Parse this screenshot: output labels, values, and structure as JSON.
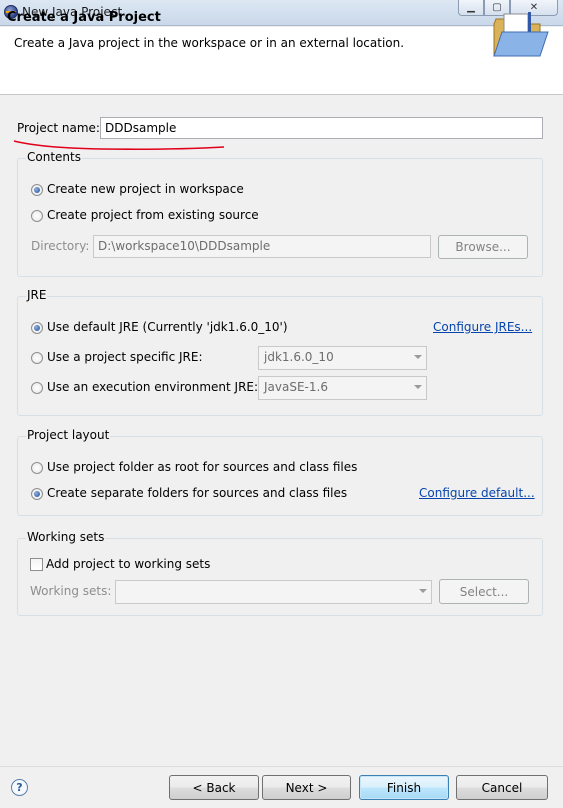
{
  "window": {
    "title": "New Java Project",
    "min_glyph": "▁",
    "max_glyph": "▢",
    "close_glyph": "✕"
  },
  "header": {
    "title": "Create a Java Project",
    "description": "Create a Java project in the workspace or in an external location."
  },
  "project_name": {
    "label": "Project name:",
    "value": "DDDsample"
  },
  "contents": {
    "title": "Contents",
    "option_new": "Create new project in workspace",
    "option_existing": "Create project from existing source",
    "selected": "option_new",
    "directory_label": "Directory:",
    "directory_value": "D:\\workspace10\\DDDsample",
    "browse_label": "Browse..."
  },
  "jre": {
    "title": "JRE",
    "option_default": "Use default JRE (Currently 'jdk1.6.0_10')",
    "configure_link": "Configure JREs...",
    "option_specific": "Use a project specific JRE:",
    "specific_value": "jdk1.6.0_10",
    "option_env": "Use an execution environment JRE:",
    "env_value": "JavaSE-1.6",
    "selected": "option_default"
  },
  "layout": {
    "title": "Project layout",
    "option_root": "Use project folder as root for sources and class files",
    "option_separate": "Create separate folders for sources and class files",
    "configure_link": "Configure default...",
    "selected": "option_separate"
  },
  "working_sets": {
    "title": "Working sets",
    "checkbox_label": "Add project to working sets",
    "checked": false,
    "sets_label": "Working sets:",
    "sets_value": "",
    "select_label": "Select..."
  },
  "footer": {
    "help_glyph": "?",
    "back_label": "< Back",
    "next_label": "Next >",
    "finish_label": "Finish",
    "cancel_label": "Cancel"
  },
  "colors": {
    "annotation": "#e0001a",
    "link": "#0645ad",
    "default_button_border": "#3c7fb1"
  }
}
